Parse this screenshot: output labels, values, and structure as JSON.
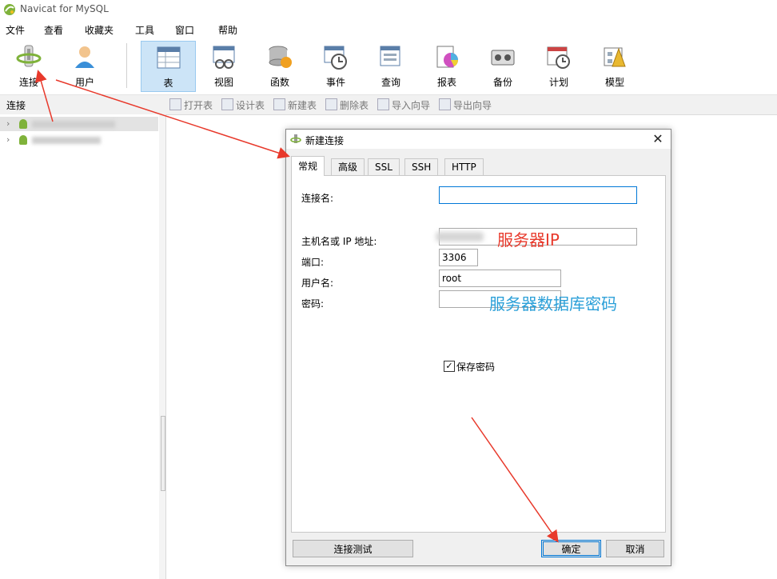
{
  "app": {
    "title": "Navicat for MySQL"
  },
  "menu": [
    "文件",
    "查看",
    "收藏夹",
    "工具",
    "窗口",
    "帮助"
  ],
  "toolbar": {
    "connect": "连接",
    "user": "用户",
    "table": "表",
    "view": "视图",
    "function": "函数",
    "event": "事件",
    "query": "查询",
    "report": "报表",
    "backup": "备份",
    "schedule": "计划",
    "model": "模型"
  },
  "subbar": {
    "connections_header": "连接",
    "open_table": "打开表",
    "design_table": "设计表",
    "new_table": "新建表",
    "delete_table": "删除表",
    "import_wizard": "导入向导",
    "export_wizard": "导出向导"
  },
  "dialog": {
    "title": "新建连接",
    "tabs": [
      "常规",
      "高级",
      "SSL",
      "SSH",
      "HTTP"
    ],
    "fields": {
      "connection_name_label": "连接名:",
      "connection_name_value": "",
      "host_label": "主机名或 IP 地址:",
      "host_value": "",
      "port_label": "端口:",
      "port_value": "3306",
      "username_label": "用户名:",
      "username_value": "root",
      "password_label": "密码:",
      "password_value": "",
      "save_password_label": "保存密码",
      "save_password_checked": true
    },
    "buttons": {
      "test": "连接测试",
      "ok": "确定",
      "cancel": "取消"
    }
  },
  "annotations": {
    "host_hint": "服务器IP",
    "password_hint": "服务器数据库密码",
    "host_hint_color": "#e8392b",
    "password_hint_color": "#2a9fd8",
    "arrow_color": "#e8392b"
  },
  "colors": {
    "toolbar_active": "#cce4f7",
    "focus_border": "#0078d7",
    "logo_green": "#7fb23a"
  }
}
